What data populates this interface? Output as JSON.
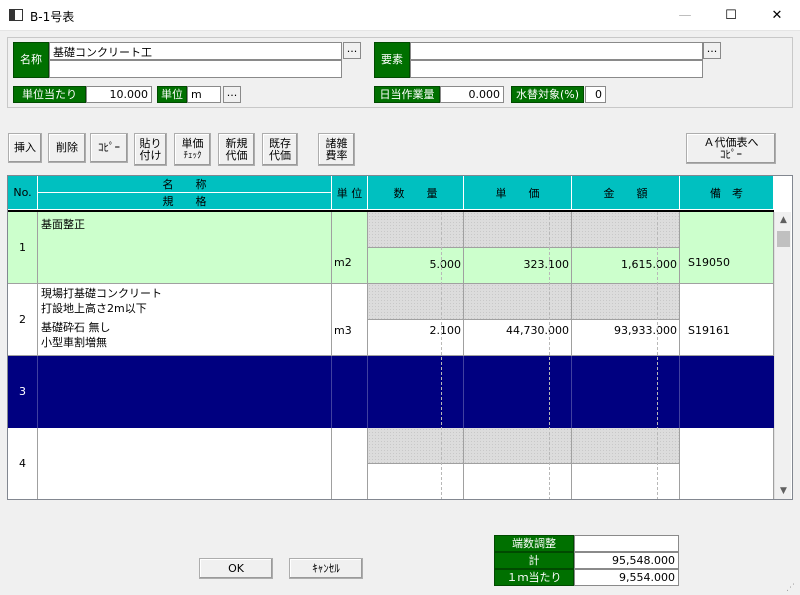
{
  "window": {
    "title": "B-1号表",
    "minimize": "—",
    "maximize": "☐",
    "close": "✕"
  },
  "header": {
    "name_label": "名称",
    "name_value": "基礎コンクリート工",
    "name_value2": "",
    "element_label": "要素",
    "element_value": "",
    "element_value2": "",
    "ellipsis": "...",
    "per_unit_label": "単位当たり",
    "per_unit_value": "10.000",
    "unit_label": "単位",
    "unit_value": "m",
    "daily_label": "日当作業量",
    "daily_value": "0.000",
    "water_label": "水替対象(%)",
    "water_value": "0"
  },
  "toolbar": {
    "insert": "挿入",
    "delete": "削除",
    "copy": "ｺﾋﾟｰ",
    "paste1": "貼り",
    "paste2": "付け",
    "price1": "単価",
    "price2": "ﾁｪｯｸ",
    "new1": "新規",
    "new2": "代価",
    "exist1": "既存",
    "exist2": "代価",
    "misc1": "諸雑",
    "misc2": "費率",
    "copy_a1": "Ａ代価表へ",
    "copy_a2": "ｺﾋﾟｰ"
  },
  "grid": {
    "headers": {
      "no": "No.",
      "name": "名　　称",
      "spec": "規　　格",
      "unit": "単 位",
      "qty": "数　　量",
      "price": "単　　価",
      "amount": "金　　額",
      "note": "備　考"
    },
    "rows": [
      {
        "no": "1",
        "name": "基面整正",
        "spec1": "",
        "spec2": "",
        "spec3": "",
        "unit": "m2",
        "qty": "5.000",
        "price": "323.100",
        "amount": "1,615.000",
        "note": "S19050"
      },
      {
        "no": "2",
        "name": "現場打基礎コンクリート",
        "spec1": "打設地上高さ2m以下",
        "spec2": "基礎砕石 無し",
        "spec3": "小型車割増無",
        "unit": "m3",
        "qty": "2.100",
        "price": "44,730.000",
        "amount": "93,933.000",
        "note": "S19161"
      },
      {
        "no": "3",
        "name": "",
        "spec1": "",
        "spec2": "",
        "spec3": "",
        "unit": "",
        "qty": "",
        "price": "",
        "amount": "",
        "note": ""
      },
      {
        "no": "4",
        "name": "",
        "spec1": "",
        "spec2": "",
        "spec3": "",
        "unit": "",
        "qty": "",
        "price": "",
        "amount": "",
        "note": ""
      }
    ],
    "selected_color": "#000080",
    "row1_color": "#ccffcc",
    "header_color": "#00c0c0"
  },
  "totals": {
    "rounding_label": "端数調整",
    "rounding_value": "",
    "total_label": "計",
    "total_value": "95,548.000",
    "per_m_label": "１ｍ当たり",
    "per_m_value": "9,554.000"
  },
  "footer": {
    "ok": "OK",
    "cancel": "ｷｬﾝｾﾙ"
  },
  "scroll": {
    "up": "▲",
    "down": "▼"
  }
}
